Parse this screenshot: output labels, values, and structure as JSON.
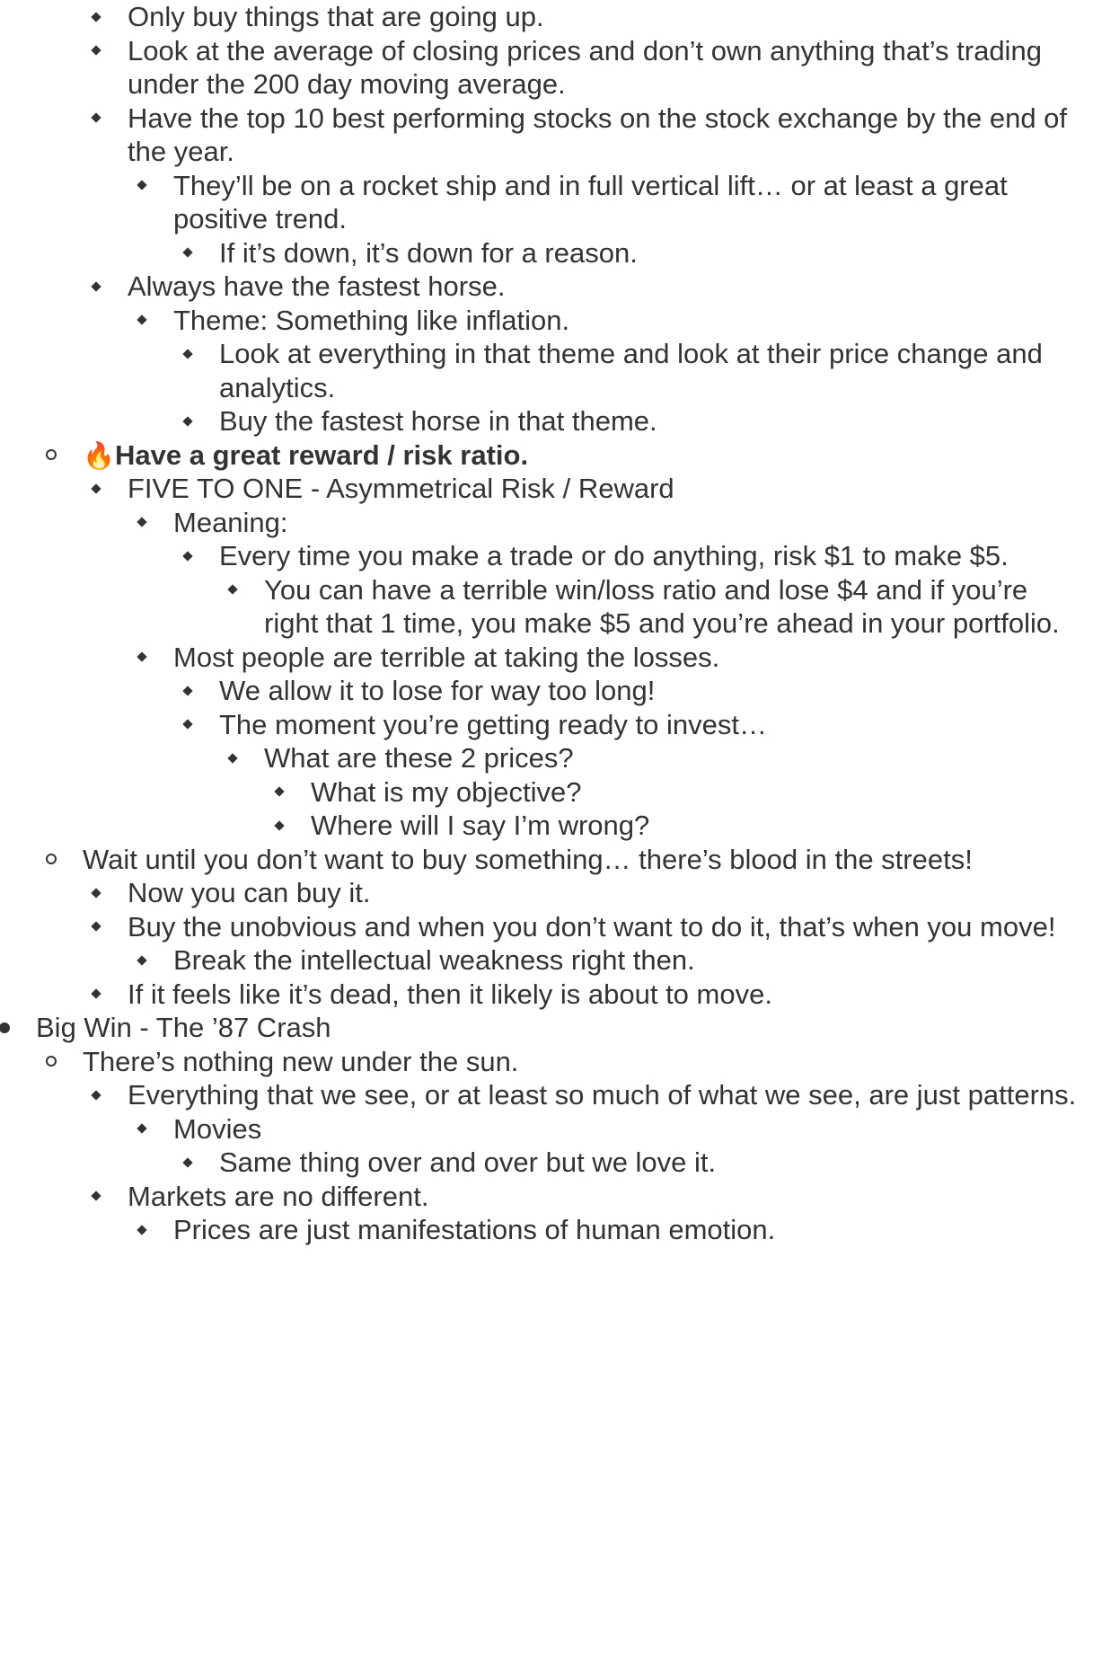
{
  "outline": [
    {
      "text": "Only buy things that are going up.",
      "level": 3,
      "marker": "diamond"
    },
    {
      "text": "Look at the average of closing prices and don’t own anything that’s trading under the 200 day moving average.",
      "level": 3,
      "marker": "diamond"
    },
    {
      "text": "Have the top 10 best performing stocks on the stock exchange by the end of the year.",
      "level": 3,
      "marker": "diamond"
    },
    {
      "text": "They’ll be on a rocket ship and in full vertical lift… or at least a great positive trend.",
      "level": 4,
      "marker": "diamond"
    },
    {
      "text": "If it’s down, it’s down for a reason.",
      "level": 5,
      "marker": "diamond"
    },
    {
      "text": "Always have the fastest horse.",
      "level": 3,
      "marker": "diamond"
    },
    {
      "text": "Theme: Something like inflation.",
      "level": 4,
      "marker": "diamond"
    },
    {
      "text": "Look at everything in that theme and look at their price change and analytics.",
      "level": 5,
      "marker": "diamond"
    },
    {
      "text": "Buy the fastest horse in that theme.",
      "level": 5,
      "marker": "diamond"
    },
    {
      "text": "Have a great reward / risk ratio.",
      "level": 2,
      "marker": "circle",
      "bold": true,
      "emoji": "🔥"
    },
    {
      "text": "FIVE TO ONE - Asymmetrical Risk / Reward",
      "level": 3,
      "marker": "diamond"
    },
    {
      "text": "Meaning:",
      "level": 4,
      "marker": "diamond"
    },
    {
      "text": "Every time you make a trade or do anything, risk $1 to make $5.",
      "level": 5,
      "marker": "diamond"
    },
    {
      "text": "You can have a terrible win/loss ratio and lose $4 and if you’re right that 1 time, you make $5 and you’re ahead in your portfolio.",
      "level": 6,
      "marker": "diamond"
    },
    {
      "text": "Most people are terrible at taking the losses.",
      "level": 4,
      "marker": "diamond"
    },
    {
      "text": "We allow it to lose for way too long!",
      "level": 5,
      "marker": "diamond"
    },
    {
      "text": "The moment you’re getting ready to invest…",
      "level": 5,
      "marker": "diamond"
    },
    {
      "text": "What are these 2 prices?",
      "level": 6,
      "marker": "diamond"
    },
    {
      "text": "What is my objective?",
      "level": 7,
      "marker": "diamond"
    },
    {
      "text": "Where will I say I’m wrong?",
      "level": 7,
      "marker": "diamond"
    },
    {
      "text": "Wait until you don’t want to buy something… there’s blood in the streets!",
      "level": 2,
      "marker": "circle"
    },
    {
      "text": "Now you can buy it.",
      "level": 3,
      "marker": "diamond"
    },
    {
      "text": "Buy the unobvious and when you don’t want to do it, that’s when you move!",
      "level": 3,
      "marker": "diamond"
    },
    {
      "text": "Break the intellectual weakness right then.",
      "level": 4,
      "marker": "diamond"
    },
    {
      "text": "If it feels like it’s dead, then it likely is about to move.",
      "level": 3,
      "marker": "diamond"
    },
    {
      "text": "Big Win - The ’87 Crash",
      "level": 1,
      "marker": "disc"
    },
    {
      "text": "There’s nothing new under the sun.",
      "level": 2,
      "marker": "circle"
    },
    {
      "text": "Everything that we see, or at least so much of what we see, are just patterns.",
      "level": 3,
      "marker": "diamond"
    },
    {
      "text": "Movies",
      "level": 4,
      "marker": "diamond"
    },
    {
      "text": "Same thing over and over but we love it.",
      "level": 5,
      "marker": "diamond"
    },
    {
      "text": "Markets are no different.",
      "level": 3,
      "marker": "diamond"
    },
    {
      "text": "Prices are just manifestations of human emotion.",
      "level": 4,
      "marker": "diamond"
    }
  ]
}
